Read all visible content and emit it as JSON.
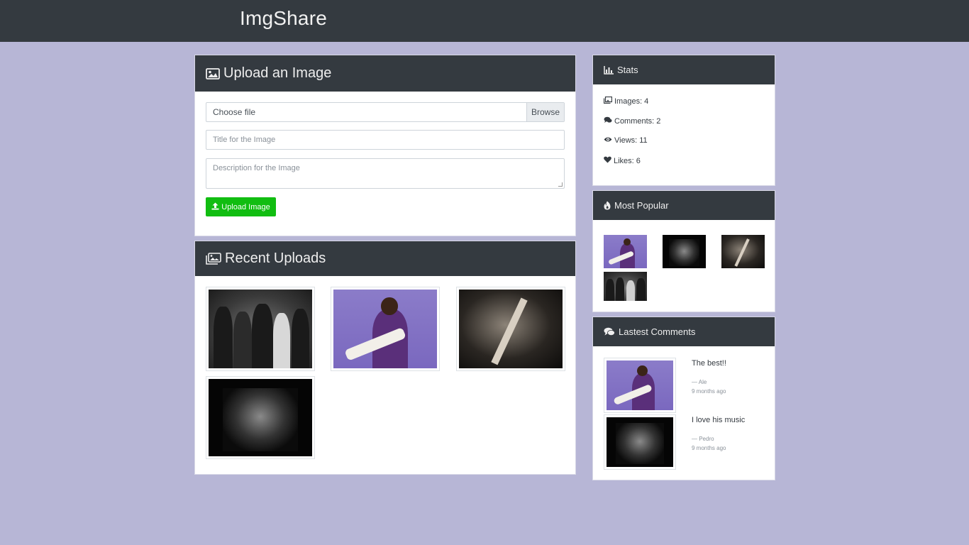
{
  "app": {
    "title": "ImgShare"
  },
  "upload": {
    "header": "Upload an Image",
    "file_label": "Choose file",
    "browse_label": "Browse",
    "title_placeholder": "Title for the Image",
    "description_placeholder": "Description for the Image",
    "button_label": "Upload Image",
    "button_color": "#11bd11"
  },
  "recent": {
    "header": "Recent Uploads",
    "images": [
      {
        "icon": "band-photo"
      },
      {
        "icon": "guitarist-purple-photo"
      },
      {
        "icon": "singer-guitar-photo"
      },
      {
        "icon": "accordion-player-photo"
      }
    ]
  },
  "stats": {
    "header": "Stats",
    "images": "Images: 4",
    "comments": "Comments: 2",
    "views": "Views: 11",
    "likes": "Likes: 6"
  },
  "popular": {
    "header": "Most Popular",
    "images": [
      {
        "icon": "guitarist-purple-photo"
      },
      {
        "icon": "accordion-player-photo"
      },
      {
        "icon": "singer-guitar-photo"
      },
      {
        "icon": "band-photo"
      }
    ]
  },
  "comments": {
    "header": "Lastest Comments",
    "items": [
      {
        "text": "The best!!",
        "author": "— Ale",
        "time": "9 months ago"
      },
      {
        "text": "I love his music",
        "author": "— Pedro",
        "time": "9 months ago"
      }
    ]
  },
  "colors": {
    "navbar": "#343a40",
    "background": "#b7b6d6",
    "header": "#343a40"
  }
}
